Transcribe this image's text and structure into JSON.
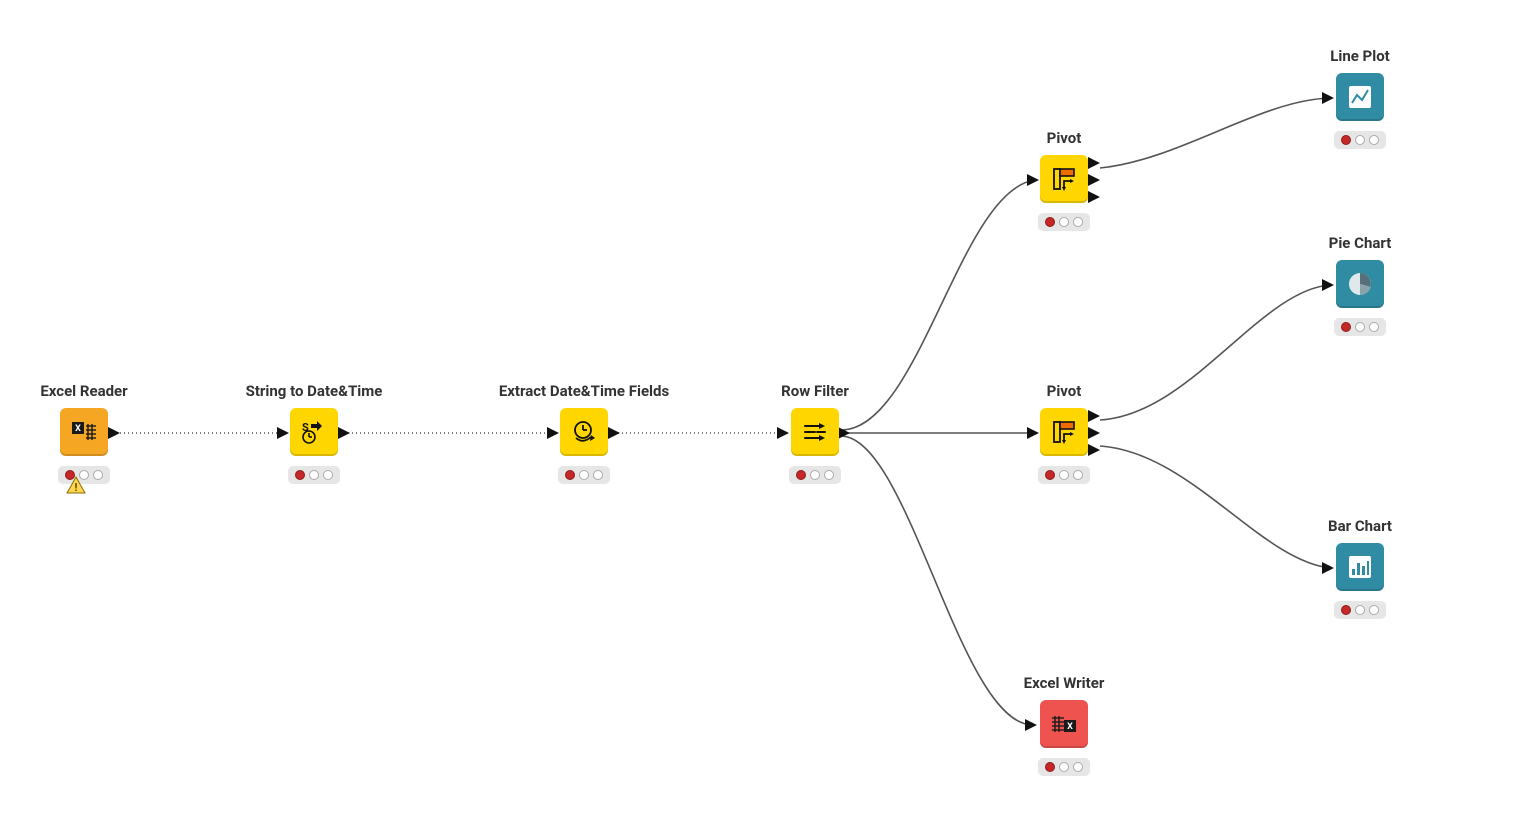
{
  "nodes": {
    "excel_reader": {
      "label": "Excel Reader",
      "color": "#f5a623",
      "icon": "excel-read"
    },
    "string_to_dt": {
      "label": "String to Date&Time",
      "color": "#ffd600",
      "icon": "s-to-clock"
    },
    "extract_dt": {
      "label": "Extract Date&Time Fields",
      "color": "#ffd600",
      "icon": "clock-arrow"
    },
    "row_filter": {
      "label": "Row Filter",
      "color": "#ffd600",
      "icon": "row-filter"
    },
    "pivot1": {
      "label": "Pivot",
      "color": "#ffd600",
      "icon": "pivot"
    },
    "pivot2": {
      "label": "Pivot",
      "color": "#ffd600",
      "icon": "pivot"
    },
    "excel_writer": {
      "label": "Excel Writer",
      "color": "#ef5350",
      "icon": "excel-write"
    },
    "line_plot": {
      "label": "Line Plot",
      "color": "#2f8ca3",
      "icon": "line-plot"
    },
    "pie_chart": {
      "label": "Pie Chart",
      "color": "#2f8ca3",
      "icon": "pie"
    },
    "bar_chart": {
      "label": "Bar Chart",
      "color": "#2f8ca3",
      "icon": "bar"
    }
  },
  "status_colors": {
    "red": "#c62828",
    "empty": "#ffffff"
  }
}
